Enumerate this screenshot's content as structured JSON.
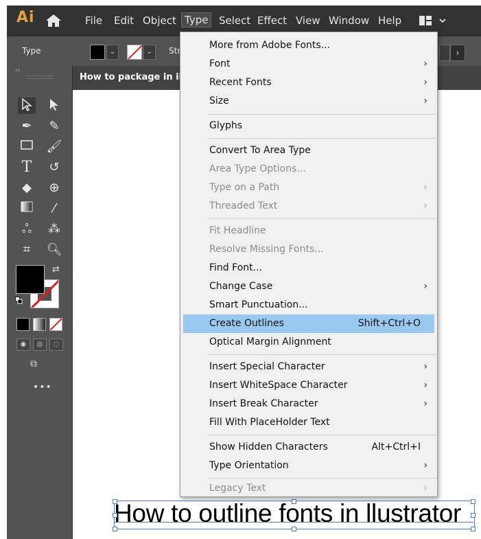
{
  "app": {
    "logo": "Ai",
    "menubar": [
      "File",
      "Edit",
      "Object",
      "Type",
      "Select",
      "Effect",
      "View",
      "Window",
      "Help"
    ],
    "active_menu": "Type"
  },
  "controlbar": {
    "selection_label": "Type",
    "stroke_label": "Str"
  },
  "document": {
    "tab_title": "How to package in illus",
    "headline_text": "How to outline fonts in llustrator"
  },
  "type_menu": {
    "items": [
      {
        "label": "More from Adobe Fonts...",
        "shortcut": "",
        "submenu": false,
        "enabled": true
      },
      {
        "label": "Font",
        "shortcut": "",
        "submenu": true,
        "enabled": true
      },
      {
        "label": "Recent Fonts",
        "shortcut": "",
        "submenu": true,
        "enabled": true
      },
      {
        "label": "Size",
        "shortcut": "",
        "submenu": true,
        "enabled": true
      },
      {
        "label": "Glyphs",
        "shortcut": "",
        "submenu": false,
        "enabled": true
      },
      {
        "label": "Convert To Area Type",
        "shortcut": "",
        "submenu": false,
        "enabled": true
      },
      {
        "label": "Area Type Options...",
        "shortcut": "",
        "submenu": false,
        "enabled": false
      },
      {
        "label": "Type on a Path",
        "shortcut": "",
        "submenu": true,
        "enabled": false
      },
      {
        "label": "Threaded Text",
        "shortcut": "",
        "submenu": true,
        "enabled": false
      },
      {
        "label": "Fit Headline",
        "shortcut": "",
        "submenu": false,
        "enabled": false
      },
      {
        "label": "Resolve Missing Fonts...",
        "shortcut": "",
        "submenu": false,
        "enabled": false
      },
      {
        "label": "Find Font...",
        "shortcut": "",
        "submenu": false,
        "enabled": true
      },
      {
        "label": "Change Case",
        "shortcut": "",
        "submenu": true,
        "enabled": true
      },
      {
        "label": "Smart Punctuation...",
        "shortcut": "",
        "submenu": false,
        "enabled": true
      },
      {
        "label": "Create Outlines",
        "shortcut": "Shift+Ctrl+O",
        "submenu": false,
        "enabled": true,
        "highlighted": true
      },
      {
        "label": "Optical Margin Alignment",
        "shortcut": "",
        "submenu": false,
        "enabled": true
      },
      {
        "label": "Insert Special Character",
        "shortcut": "",
        "submenu": true,
        "enabled": true
      },
      {
        "label": "Insert WhiteSpace Character",
        "shortcut": "",
        "submenu": true,
        "enabled": true
      },
      {
        "label": "Insert Break Character",
        "shortcut": "",
        "submenu": true,
        "enabled": true
      },
      {
        "label": "Fill With PlaceHolder Text",
        "shortcut": "",
        "submenu": false,
        "enabled": true
      },
      {
        "label": "Show Hidden Characters",
        "shortcut": "Alt+Ctrl+I",
        "submenu": false,
        "enabled": true
      },
      {
        "label": "Type Orientation",
        "shortcut": "",
        "submenu": true,
        "enabled": true
      },
      {
        "label": "Legacy Text",
        "shortcut": "",
        "submenu": true,
        "enabled": false
      }
    ]
  },
  "colors": {
    "menu_highlight": "#99c9ef",
    "logo": "#e8a13c",
    "selection_blue": "#4a7bd4"
  }
}
